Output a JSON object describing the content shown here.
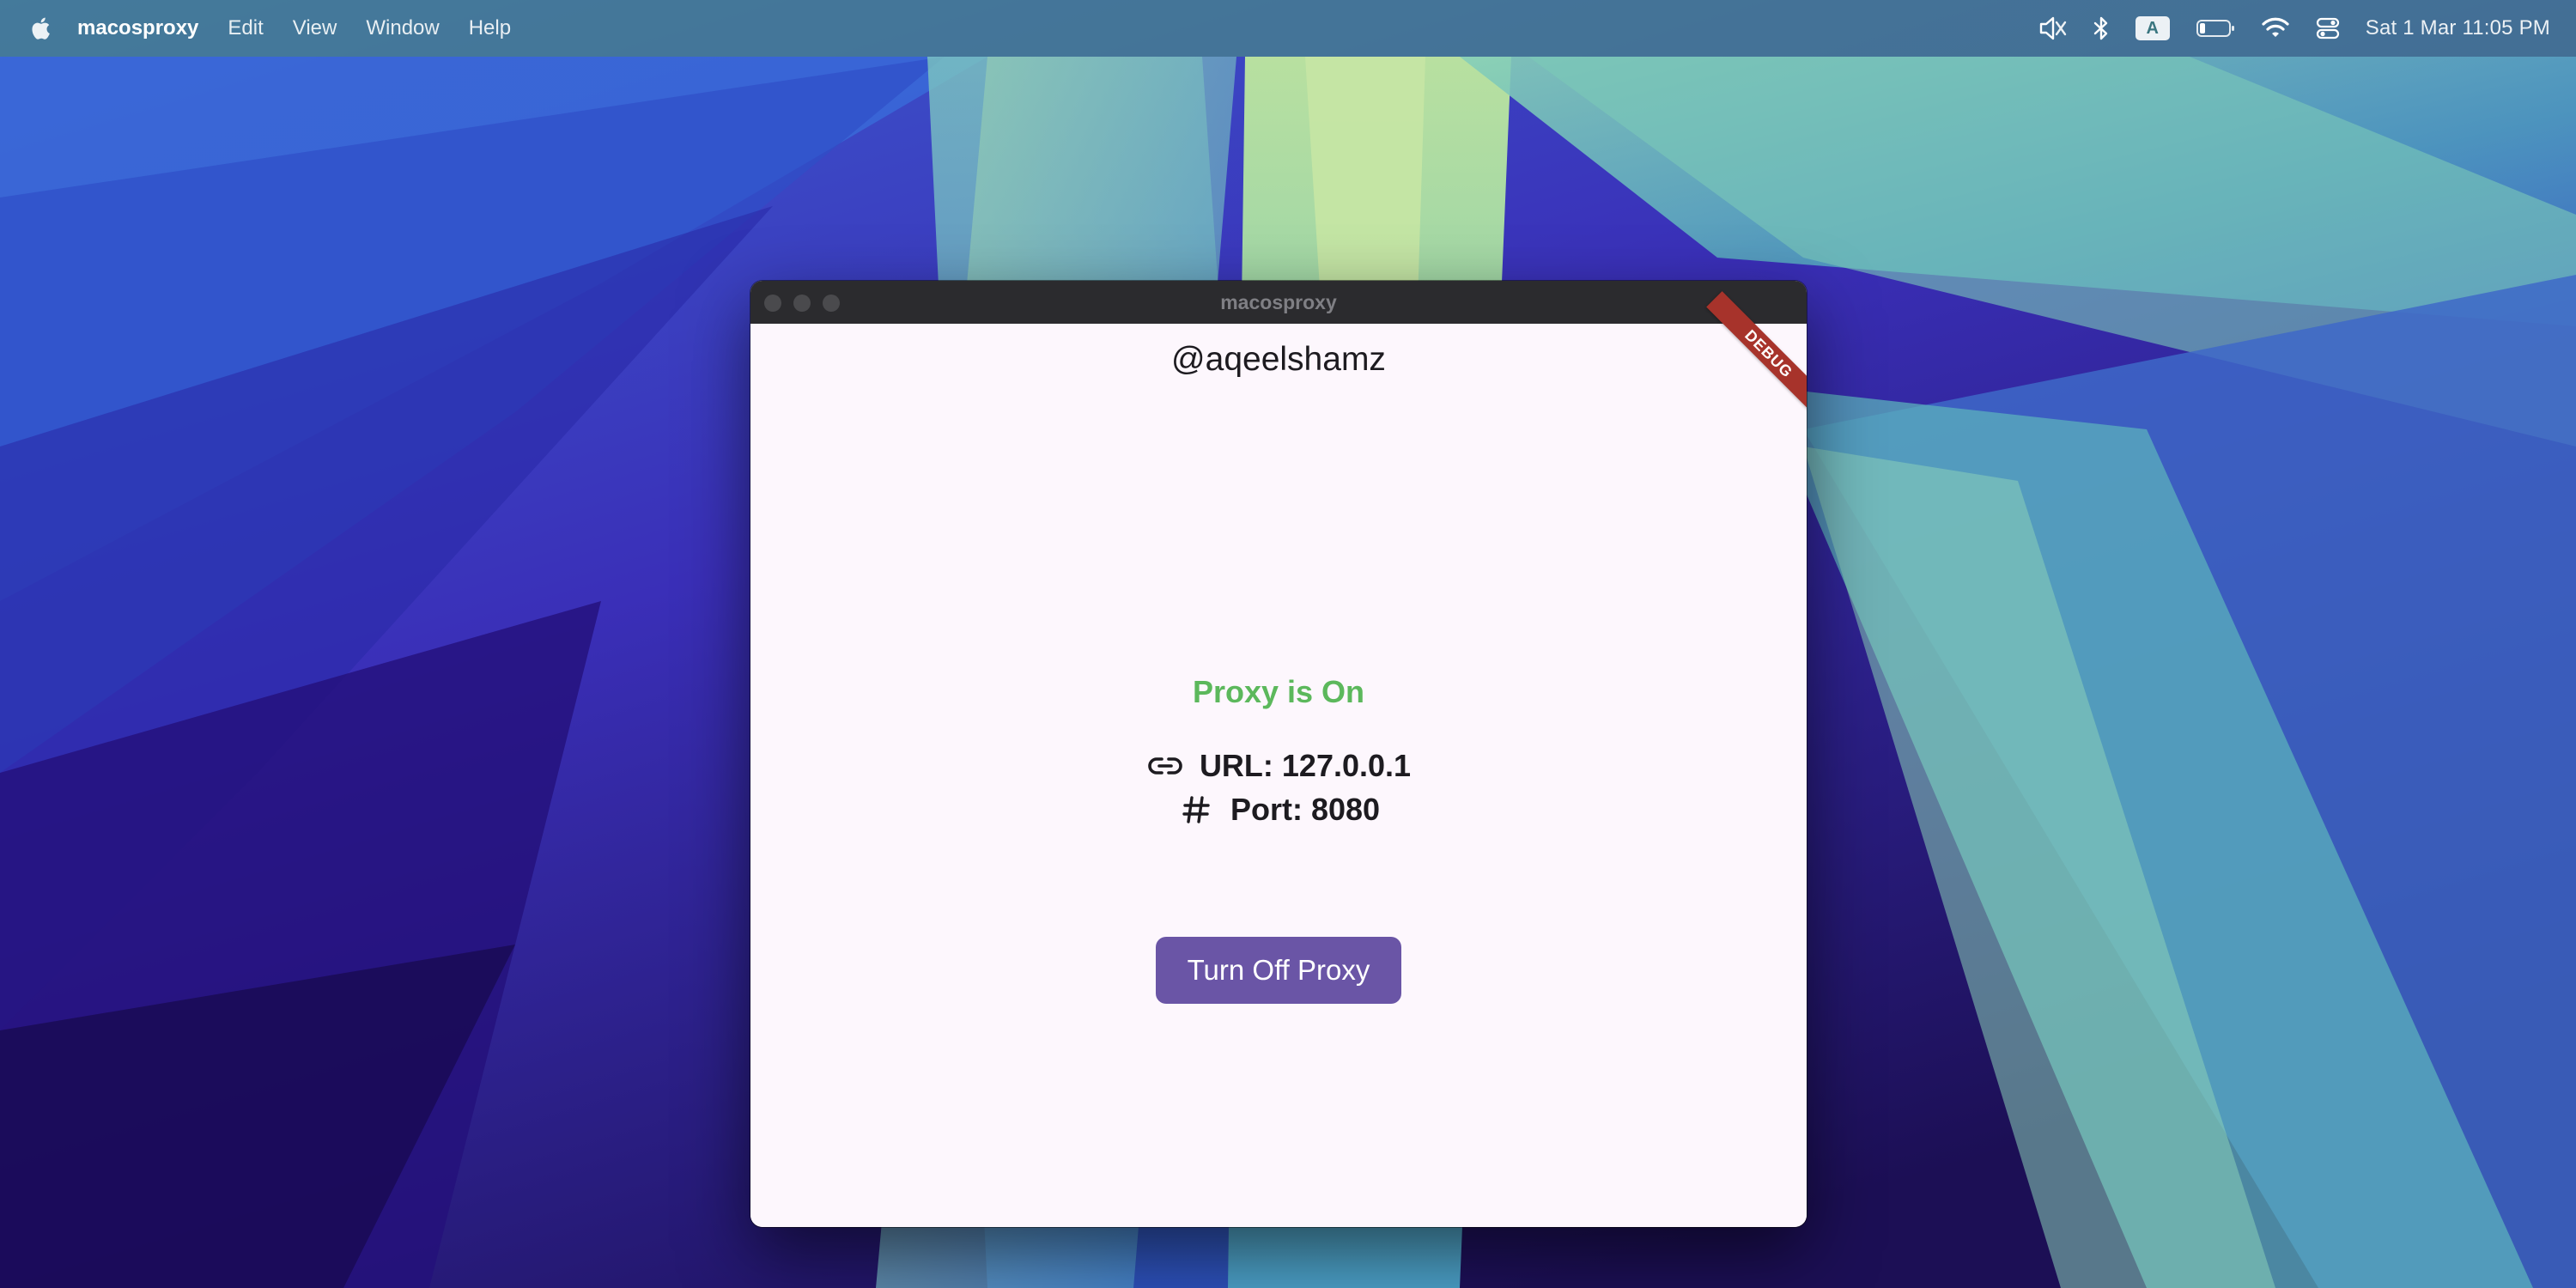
{
  "menubar": {
    "app_name": "macosproxy",
    "items": [
      "Edit",
      "View",
      "Window",
      "Help"
    ],
    "input_source": "A",
    "clock": "Sat 1 Mar  11:05 PM"
  },
  "window": {
    "title": "macosproxy",
    "debug_label": "DEBUG"
  },
  "app": {
    "username": "@aqeelshamz",
    "status": "Proxy is On",
    "status_color": "#5cb85c",
    "url_label": "URL: 127.0.0.1",
    "port_label": "Port: 8080",
    "button_label": "Turn Off Proxy",
    "button_color": "#6a55a6"
  }
}
